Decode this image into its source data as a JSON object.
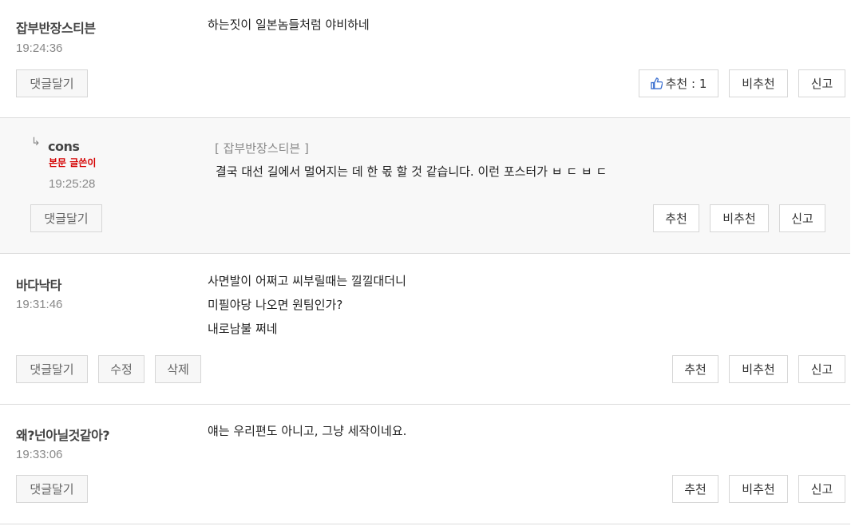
{
  "comments": [
    {
      "author": "잡부반장스티븐",
      "time": "19:24:36",
      "lines": [
        "하는짓이 일본놈들처럼 야비하네"
      ],
      "buttons": {
        "reply": "댓글달기",
        "recommend": "추천 : 1",
        "not_recommend": "비추천",
        "report": "신고"
      }
    },
    {
      "author": "cons",
      "badge": "본문 글쓴이",
      "time": "19:25:28",
      "reply_arrow": "↳",
      "quote": "[ 잡부반장스티븐 ]",
      "lines": [
        "결국 대선 길에서 멀어지는 데 한 몫 할 것 같습니다. 이런 포스터가 ㅂ ㄷ ㅂ ㄷ"
      ],
      "buttons": {
        "reply": "댓글달기",
        "recommend": "추천",
        "not_recommend": "비추천",
        "report": "신고"
      }
    },
    {
      "author": "바다낙타",
      "time": "19:31:46",
      "lines": [
        "사면발이 어쩌고 씨부릴때는 낄낄대더니",
        "미필야당 나오면 원팀인가?",
        "내로남불 쩌네"
      ],
      "buttons": {
        "reply": "댓글달기",
        "edit": "수정",
        "delete": "삭제",
        "recommend": "추천",
        "not_recommend": "비추천",
        "report": "신고"
      }
    },
    {
      "author": "왜?넌아닐것같아?",
      "time": "19:33:06",
      "lines": [
        "얘는 우리편도 아니고, 그냥 세작이네요."
      ],
      "buttons": {
        "reply": "댓글달기",
        "recommend": "추천",
        "not_recommend": "비추천",
        "report": "신고"
      }
    }
  ],
  "colors": {
    "badge": "#d40000",
    "thumb": "#3a6fd0",
    "border": "#dcdcdc",
    "reply_bg": "#f8f8f8"
  },
  "icons": {
    "thumb": "thumbs-up-icon"
  }
}
